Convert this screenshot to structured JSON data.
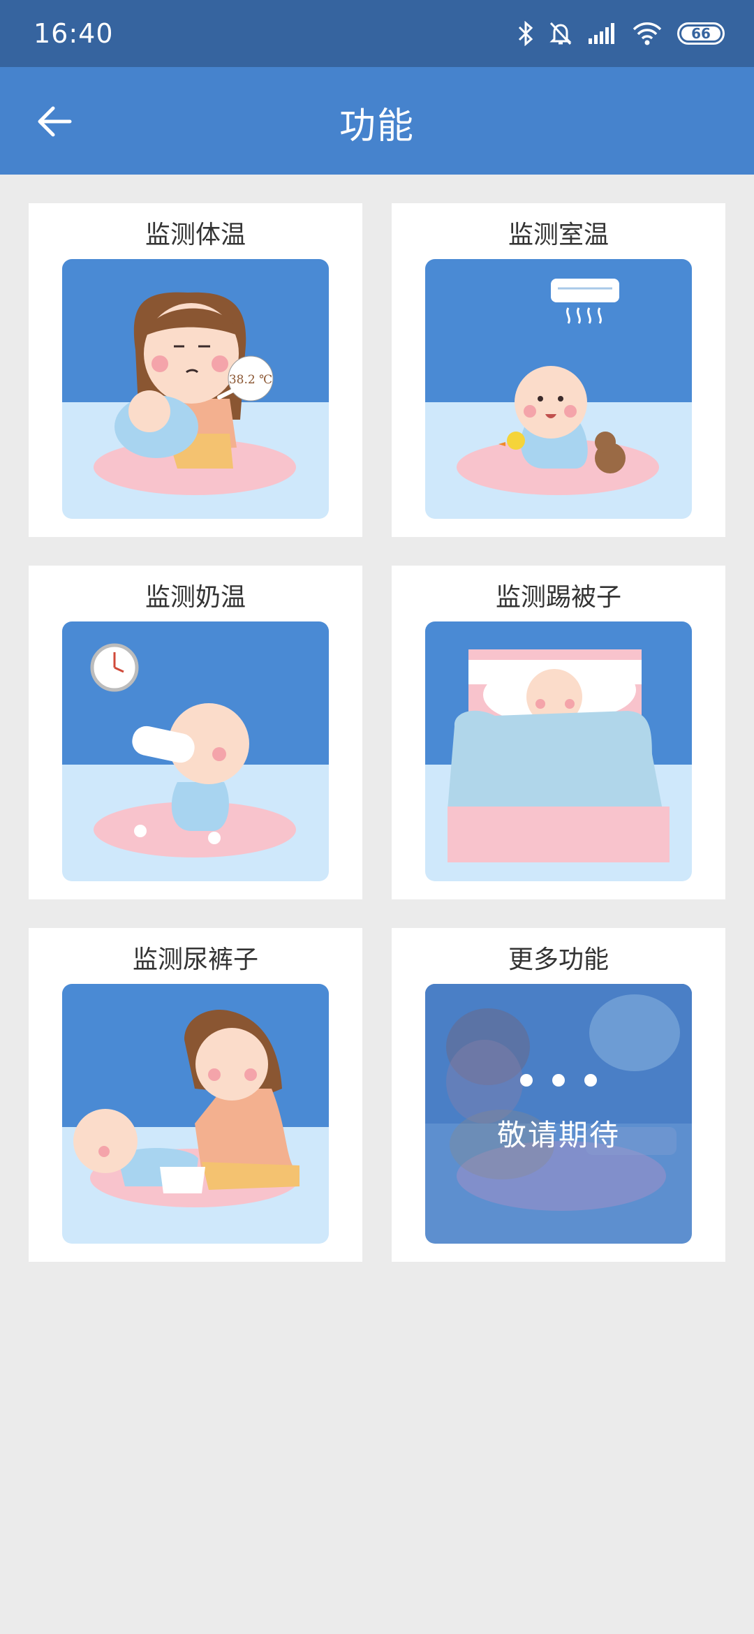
{
  "status_bar": {
    "time": "16:40",
    "battery": "66",
    "icons": [
      "bluetooth-icon",
      "bell-off-icon",
      "signal-icon",
      "wifi-icon",
      "battery-icon"
    ]
  },
  "header": {
    "title": "功能",
    "back_icon": "arrow-left-icon"
  },
  "cards": [
    {
      "label": "监测体温"
    },
    {
      "label": "监测室温"
    },
    {
      "label": "监测奶温"
    },
    {
      "label": "监测踢被子"
    },
    {
      "label": "监测尿裤子"
    },
    {
      "label": "更多功能",
      "overlay_text": "敬请期待"
    }
  ],
  "illustration_text": {
    "thermometer_reading": "38.2 ℃"
  },
  "colors": {
    "status_bar": "#36649f",
    "app_bar": "#4683cd",
    "background": "#ebebeb",
    "scene_sky": "#4a8ad4",
    "scene_floor": "#cfe8fb",
    "rug": "#f8c3cc"
  }
}
